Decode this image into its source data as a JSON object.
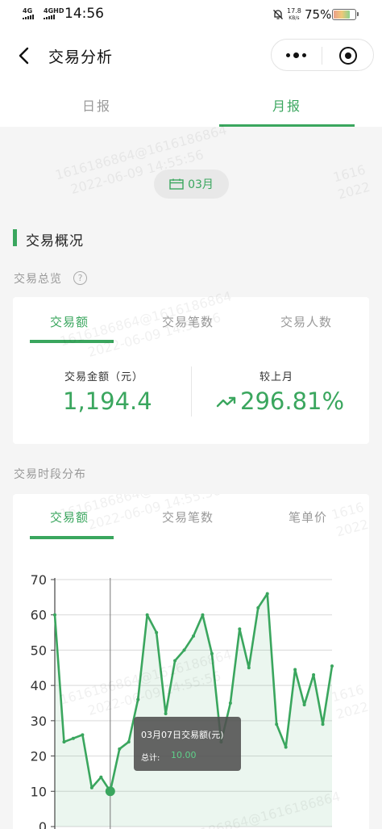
{
  "status_bar": {
    "network1": "4G",
    "network2": "4GHD",
    "time": "14:56",
    "speed_value": "17.8",
    "speed_unit": "KB/s",
    "battery": "75%",
    "battery_level": 0.75
  },
  "nav": {
    "title": "交易分析"
  },
  "top_tabs": [
    {
      "label": "日报",
      "active": false
    },
    {
      "label": "月报",
      "active": true
    }
  ],
  "month": "03月",
  "section": {
    "title": "交易概况",
    "overview_title": "交易总览",
    "help_glyph": "?",
    "distribution_title": "交易时段分布"
  },
  "overview": {
    "tabs": [
      "交易额",
      "交易笔数",
      "交易人数"
    ],
    "amount_label": "交易金额（元）",
    "amount_value": "1,194.4",
    "compare_label": "较上月",
    "compare_value": "296.81%"
  },
  "distribution": {
    "tabs": [
      "交易额",
      "交易笔数",
      "笔单价"
    ]
  },
  "watermark": {
    "line1": "1616186864@1616186864",
    "line2": "2022-06-09 14:55:56",
    "partial1": "1616",
    "partial2": "2022"
  },
  "colors": {
    "accent": "#3aa65e",
    "tooltip_value": "#5fd18a"
  },
  "chart_data": {
    "type": "area",
    "title": "",
    "xlabel": "",
    "ylabel": "",
    "y_ticks": [
      "70",
      "60",
      "50",
      "40",
      "30",
      "20",
      "10",
      "0"
    ],
    "ylim": [
      0,
      70
    ],
    "grid": true,
    "series": [
      {
        "values": [
          60,
          24,
          25,
          26,
          11,
          14,
          10,
          22,
          24,
          36,
          60,
          55,
          32,
          47,
          50,
          54,
          60,
          49,
          24,
          35,
          56,
          45,
          62,
          66,
          29,
          22.5,
          44.5,
          34.5,
          43,
          29,
          45.5
        ]
      }
    ],
    "highlight_index": 6,
    "tooltip": {
      "title": "03月07日交易额(元)",
      "label": "总计:",
      "value": "10.00"
    }
  }
}
